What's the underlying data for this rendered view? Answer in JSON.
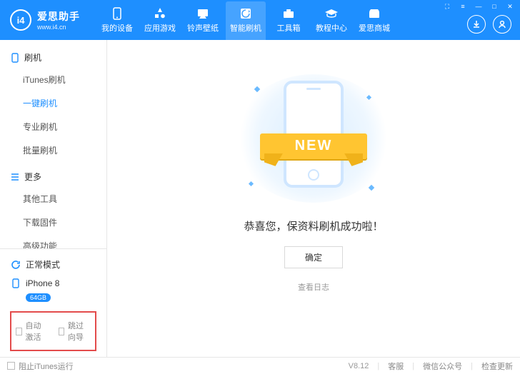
{
  "window_controls": {
    "cart": "⛶",
    "menu": "≡",
    "min": "—",
    "max": "□",
    "close": "✕"
  },
  "logo": {
    "mark": "i4",
    "cn": "爱思助手",
    "en": "www.i4.cn"
  },
  "nav": [
    {
      "key": "device",
      "label": "我的设备"
    },
    {
      "key": "apps",
      "label": "应用游戏"
    },
    {
      "key": "ringtone",
      "label": "铃声壁纸"
    },
    {
      "key": "flash",
      "label": "智能刷机"
    },
    {
      "key": "toolbox",
      "label": "工具箱"
    },
    {
      "key": "tutorial",
      "label": "教程中心"
    },
    {
      "key": "mall",
      "label": "爱思商城"
    }
  ],
  "nav_active": "flash",
  "sidebar": {
    "groups": [
      {
        "title": "刷机",
        "icon": "phone-icon",
        "items": [
          {
            "label": "iTunes刷机"
          },
          {
            "label": "一键刷机",
            "active": true
          },
          {
            "label": "专业刷机"
          },
          {
            "label": "批量刷机"
          }
        ]
      },
      {
        "title": "更多",
        "icon": "menu-icon",
        "items": [
          {
            "label": "其他工具"
          },
          {
            "label": "下载固件"
          },
          {
            "label": "高级功能"
          }
        ]
      }
    ],
    "mode": {
      "label": "正常模式"
    },
    "device": {
      "name": "iPhone 8",
      "storage": "64GB"
    },
    "checks": {
      "auto_activate": "自动激活",
      "skip_guide": "跳过向导"
    }
  },
  "main": {
    "ribbon": "NEW",
    "success_text": "恭喜您，保资料刷机成功啦！",
    "confirm": "确定",
    "view_log": "查看日志"
  },
  "footer": {
    "block_itunes": "阻止iTunes运行",
    "version": "V8.12",
    "service": "客服",
    "wechat": "微信公众号",
    "update": "检查更新"
  }
}
